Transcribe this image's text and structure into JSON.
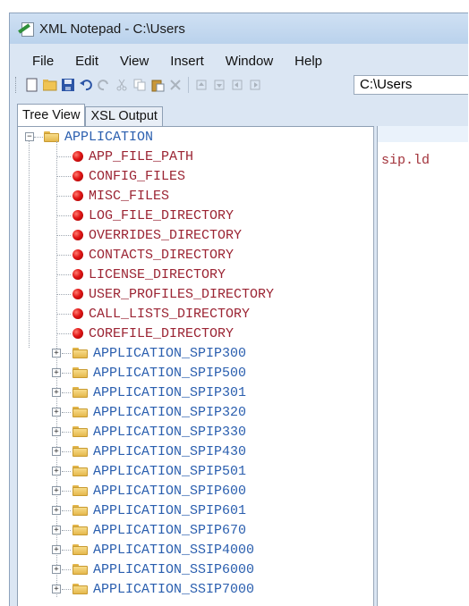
{
  "window": {
    "title": "XML Notepad - C:\\Users"
  },
  "menu": [
    "File",
    "Edit",
    "View",
    "Insert",
    "Window",
    "Help"
  ],
  "toolbar": {
    "icons": [
      "new-icon",
      "open-icon",
      "save-icon",
      "undo-icon",
      "redo-icon",
      "cut-icon",
      "copy-icon",
      "paste-icon",
      "delete-icon",
      "nudge-up-icon",
      "nudge-down-icon",
      "nudge-left-icon",
      "nudge-right-icon"
    ],
    "path_value": "C:\\Users"
  },
  "tabs": [
    "Tree View",
    "XSL Output"
  ],
  "tree": {
    "root": "APPLICATION",
    "leaves": [
      "APP_FILE_PATH",
      "CONFIG_FILES",
      "MISC_FILES",
      "LOG_FILE_DIRECTORY",
      "OVERRIDES_DIRECTORY",
      "CONTACTS_DIRECTORY",
      "LICENSE_DIRECTORY",
      "USER_PROFILES_DIRECTORY",
      "CALL_LISTS_DIRECTORY",
      "COREFILE_DIRECTORY"
    ],
    "folders": [
      "APPLICATION_SPIP300",
      "APPLICATION_SPIP500",
      "APPLICATION_SPIP301",
      "APPLICATION_SPIP320",
      "APPLICATION_SPIP330",
      "APPLICATION_SPIP430",
      "APPLICATION_SPIP501",
      "APPLICATION_SPIP600",
      "APPLICATION_SPIP601",
      "APPLICATION_SPIP670",
      "APPLICATION_SSIP4000",
      "APPLICATION_SSIP6000",
      "APPLICATION_SSIP7000"
    ]
  },
  "values": {
    "app_file_path": "sip.ld"
  },
  "colors": {
    "folder_text": "#2b5faf",
    "leaf_text": "#9b2433",
    "leaf_icon": "#e01616"
  }
}
